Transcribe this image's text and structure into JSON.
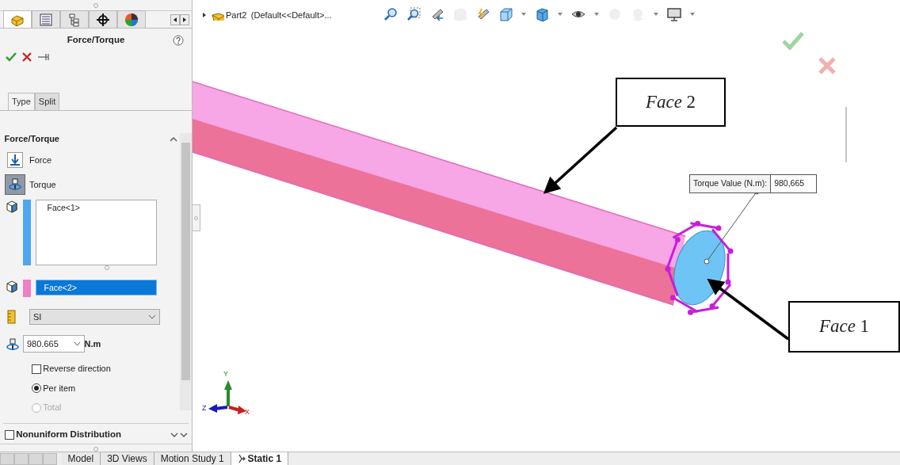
{
  "property_manager": {
    "tabs": [
      {
        "kind": "part",
        "selected": true
      },
      {
        "kind": "list",
        "selected": false
      },
      {
        "kind": "tree",
        "selected": false
      },
      {
        "kind": "target",
        "selected": false
      },
      {
        "kind": "appearance",
        "selected": false
      }
    ],
    "title": "Force/Torque",
    "subtabs": [
      {
        "label": "Type",
        "selected": true
      },
      {
        "label": "Split",
        "selected": false
      }
    ],
    "section": {
      "title": "Force/Torque",
      "expanded": true
    },
    "type_options": [
      {
        "kind": "force",
        "label": "Force",
        "selected": false
      },
      {
        "kind": "torque",
        "label": "Torque",
        "selected": true
      }
    ],
    "selection_lists": [
      {
        "color": "#4da6f2",
        "items": [
          "Face<1>"
        ],
        "highlighted": false,
        "tall": true
      },
      {
        "color": "#f27ec3",
        "items": [
          "Face<2>"
        ],
        "highlighted": true,
        "tall": false
      }
    ],
    "units": {
      "value": "SI"
    },
    "torque": {
      "value": "980.665",
      "unit": "N.m"
    },
    "reverse_direction": {
      "label": "Reverse direction",
      "checked": false
    },
    "distribution": [
      {
        "label": "Per item",
        "selected": true,
        "disabled": false
      },
      {
        "label": "Total",
        "selected": false,
        "disabled": true
      }
    ],
    "nonuniform": {
      "label": "Nonuniform Distribution",
      "checked": false,
      "expanded": false
    }
  },
  "breadcrumb": {
    "part": "Part2",
    "config": "(Default<<Default>..."
  },
  "toolbar": [
    {
      "kind": "zoom-fit",
      "disabled": false
    },
    {
      "kind": "zoom-area",
      "disabled": false
    },
    {
      "kind": "previous",
      "disabled": false
    },
    {
      "kind": "section",
      "disabled": true
    },
    {
      "kind": "dynamic",
      "disabled": false
    },
    {
      "kind": "orientation",
      "disabled": false
    },
    {
      "kind": "display",
      "disabled": false
    },
    {
      "kind": "hide",
      "disabled": false
    },
    {
      "kind": "appearance",
      "disabled": true
    },
    {
      "kind": "scene",
      "disabled": true
    },
    {
      "kind": "settings",
      "disabled": false
    }
  ],
  "viewport": {
    "tooltip": {
      "label": "Torque Value (N.m):",
      "value": "980,665"
    },
    "callouts": [
      {
        "kind": "face2",
        "text": "*Face* 2"
      },
      {
        "kind": "face1",
        "text": "*Face* 1"
      }
    ],
    "axes": [
      {
        "kind": "y",
        "label": "Y"
      },
      {
        "kind": "z",
        "label": "Z"
      },
      {
        "kind": "x",
        "label": "X"
      }
    ]
  },
  "bottom_tabs": [
    {
      "label": "Model",
      "selected": false
    },
    {
      "label": "3D Views",
      "selected": false
    },
    {
      "label": "Motion Study 1",
      "selected": false
    },
    {
      "label": "Static 1",
      "selected": true
    }
  ]
}
